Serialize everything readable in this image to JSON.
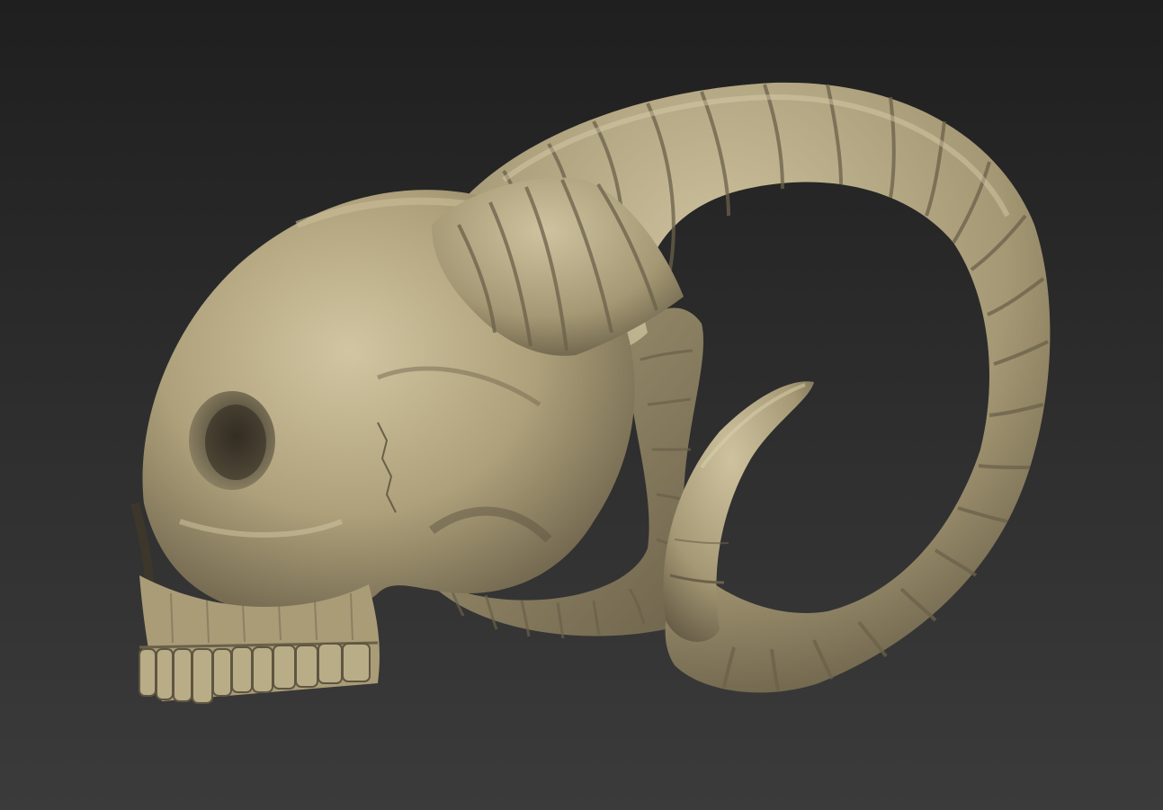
{
  "viewport": {
    "background_top": "#1f1f1f",
    "background_bottom": "#3b3b3b"
  },
  "model": {
    "material_color": "#b3a57f",
    "highlight_color": "#d6cba8",
    "shadow_color": "#5d5440"
  }
}
